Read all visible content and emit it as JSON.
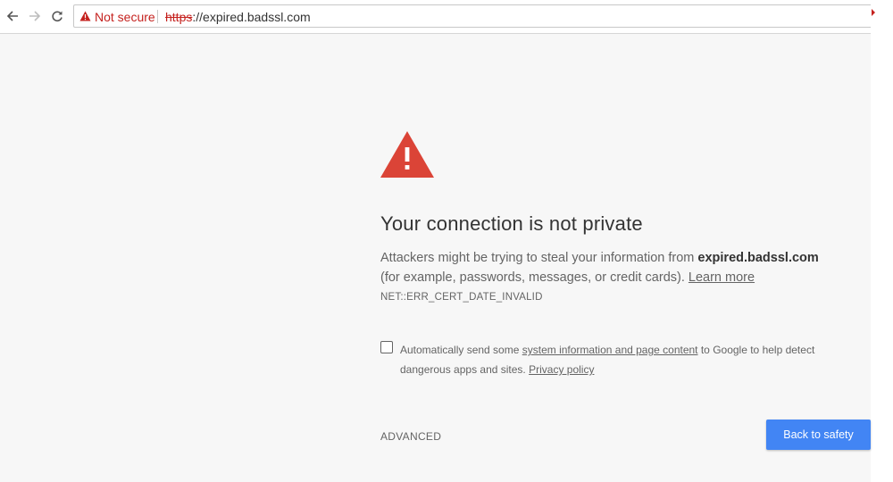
{
  "toolbar": {
    "back_icon": "arrow-left-icon",
    "forward_icon": "arrow-right-icon",
    "reload_icon": "reload-icon",
    "security_icon": "warning-triangle-icon",
    "security_label": "Not secure",
    "url_scheme": "https",
    "url_rest": "://expired.badssl.com"
  },
  "interstitial": {
    "icon": "warning-triangle-icon",
    "heading": "Your connection is not private",
    "desc_before": "Attackers might be trying to steal your information from ",
    "desc_host": "expired.badssl.com",
    "desc_after": " (for example, passwords, messages, or credit cards). ",
    "learn_more": "Learn more",
    "error_code": "NET::ERR_CERT_DATE_INVALID",
    "checkbox_checked": false,
    "opt_before": "Automatically send some ",
    "opt_link": "system information and page content",
    "opt_after": " to Google to help detect dangerous apps and sites. ",
    "privacy_link": "Privacy policy",
    "advanced_label": "ADVANCED",
    "back_button": "Back to safety"
  },
  "colors": {
    "warning_red": "#db4437",
    "not_secure_red": "#c5221f",
    "primary_blue": "#4285f4",
    "page_background": "#f7f7f7",
    "body_text": "#646464"
  }
}
